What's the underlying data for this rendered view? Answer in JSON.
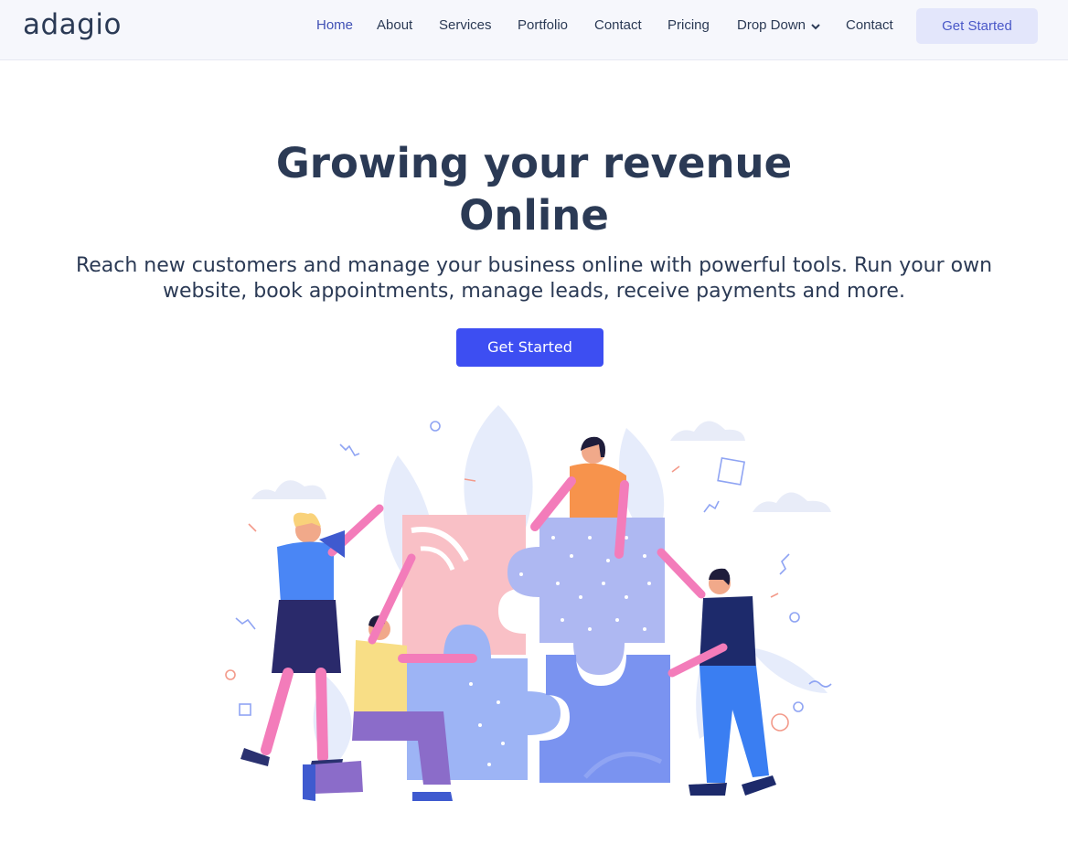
{
  "brand": {
    "name": "adagio"
  },
  "nav": {
    "items": [
      {
        "label": "Home",
        "active": true
      },
      {
        "label": "About"
      },
      {
        "label": "Services"
      },
      {
        "label": "Portfolio"
      },
      {
        "label": "Contact"
      },
      {
        "label": "Pricing"
      },
      {
        "label": "Drop Down",
        "icon": "chevron-down-icon"
      },
      {
        "label": "Contact"
      }
    ],
    "cta_label": "Get Started"
  },
  "hero": {
    "title_line1": "Growing your revenue",
    "title_line2": "Online",
    "subtitle_line1": "Reach new customers and manage your business online with powerful tools. Run your own",
    "subtitle_line2": "website, book appointments, manage leads, receive payments and more.",
    "cta_label": "Get Started"
  },
  "colors": {
    "primary": "#3d4ef2",
    "nav_active": "#4051b5",
    "text": "#2b3a55",
    "nav_bg": "#f6f7fc",
    "nav_cta_bg": "#e3e6fb"
  }
}
